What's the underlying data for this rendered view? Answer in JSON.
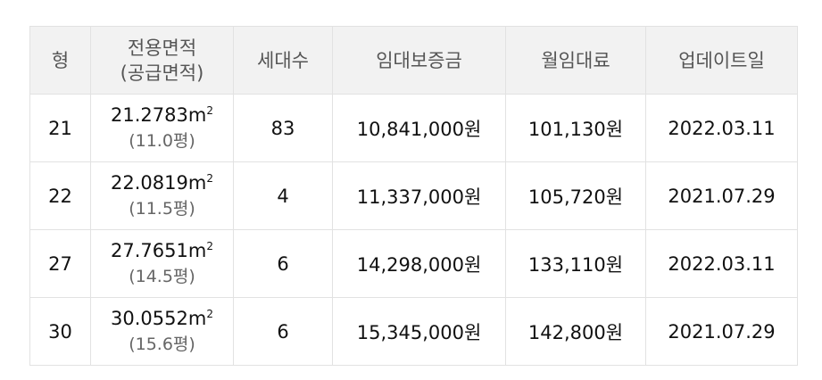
{
  "headers": {
    "type": "형",
    "area_line1": "전용면적",
    "area_line2": "(공급면적)",
    "units": "세대수",
    "deposit": "임대보증금",
    "rent": "월임대료",
    "updated": "업데이트일"
  },
  "area_unit": "m",
  "area_unit_sup": "2",
  "rows": [
    {
      "type": "21",
      "area": "21.2783",
      "supply_area": "(11.0평)",
      "units": "83",
      "deposit": "10,841,000원",
      "rent": "101,130원",
      "updated": "2022.03.11"
    },
    {
      "type": "22",
      "area": "22.0819",
      "supply_area": "(11.5평)",
      "units": "4",
      "deposit": "11,337,000원",
      "rent": "105,720원",
      "updated": "2021.07.29"
    },
    {
      "type": "27",
      "area": "27.7651",
      "supply_area": "(14.5평)",
      "units": "6",
      "deposit": "14,298,000원",
      "rent": "133,110원",
      "updated": "2022.03.11"
    },
    {
      "type": "30",
      "area": "30.0552",
      "supply_area": "(15.6평)",
      "units": "6",
      "deposit": "15,345,000원",
      "rent": "142,800원",
      "updated": "2021.07.29"
    }
  ]
}
